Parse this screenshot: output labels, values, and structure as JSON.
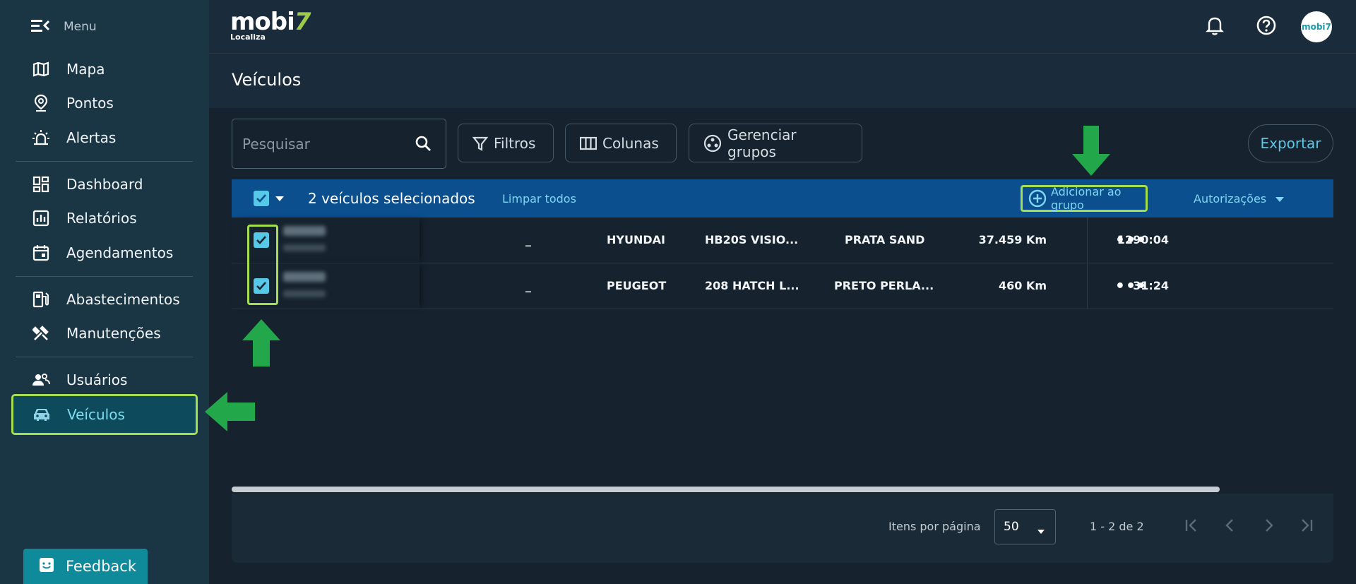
{
  "sidebar": {
    "menu_label": "Menu",
    "items": [
      {
        "label": "Mapa",
        "icon": "map-icon"
      },
      {
        "label": "Pontos",
        "icon": "location-pin-icon"
      },
      {
        "label": "Alertas",
        "icon": "siren-icon"
      },
      {
        "label": "Dashboard",
        "icon": "dashboard-icon"
      },
      {
        "label": "Relatórios",
        "icon": "bar-chart-icon"
      },
      {
        "label": "Agendamentos",
        "icon": "calendar-icon"
      },
      {
        "label": "Abastecimentos",
        "icon": "fuel-icon"
      },
      {
        "label": "Manutenções",
        "icon": "tools-icon"
      },
      {
        "label": "Usuários",
        "icon": "users-icon"
      },
      {
        "label": "Veículos",
        "icon": "car-icon",
        "active": true
      }
    ],
    "feedback_label": "Feedback"
  },
  "header": {
    "logo_text": "mobi",
    "logo_seven": "7",
    "logo_sub": "Localiza",
    "avatar_text": "mobi7"
  },
  "page": {
    "title": "Veículos"
  },
  "toolbar": {
    "search_placeholder": "Pesquisar",
    "filters_label": "Filtros",
    "columns_label": "Colunas",
    "groups_label": "Gerenciar grupos",
    "export_label": "Exportar"
  },
  "selection": {
    "count_text": "2 veículos selecionados",
    "clear_label": "Limpar todos",
    "add_group_label": "Adicionar ao grupo",
    "authorizations_label": "Autorizações"
  },
  "rows": [
    {
      "col1": "_",
      "brand": "HYUNDAI",
      "model": "HB20S VISIO...",
      "color": "PRATA SAND",
      "km": "37.459 Km",
      "hours": "1290:04"
    },
    {
      "col1": "_",
      "brand": "PEUGEOT",
      "model": "208 HATCH L...",
      "color": "PRETO PERLA...",
      "km": "460 Km",
      "hours": "31:24"
    }
  ],
  "footer": {
    "items_per_page_label": "Itens por página",
    "items_per_page_value": "50",
    "range_text": "1 - 2 de 2"
  },
  "colors": {
    "accent": "#56c9e8",
    "highlight": "#a5df4f",
    "arrow": "#22a84a",
    "selection_bar": "#0b4f8f"
  }
}
